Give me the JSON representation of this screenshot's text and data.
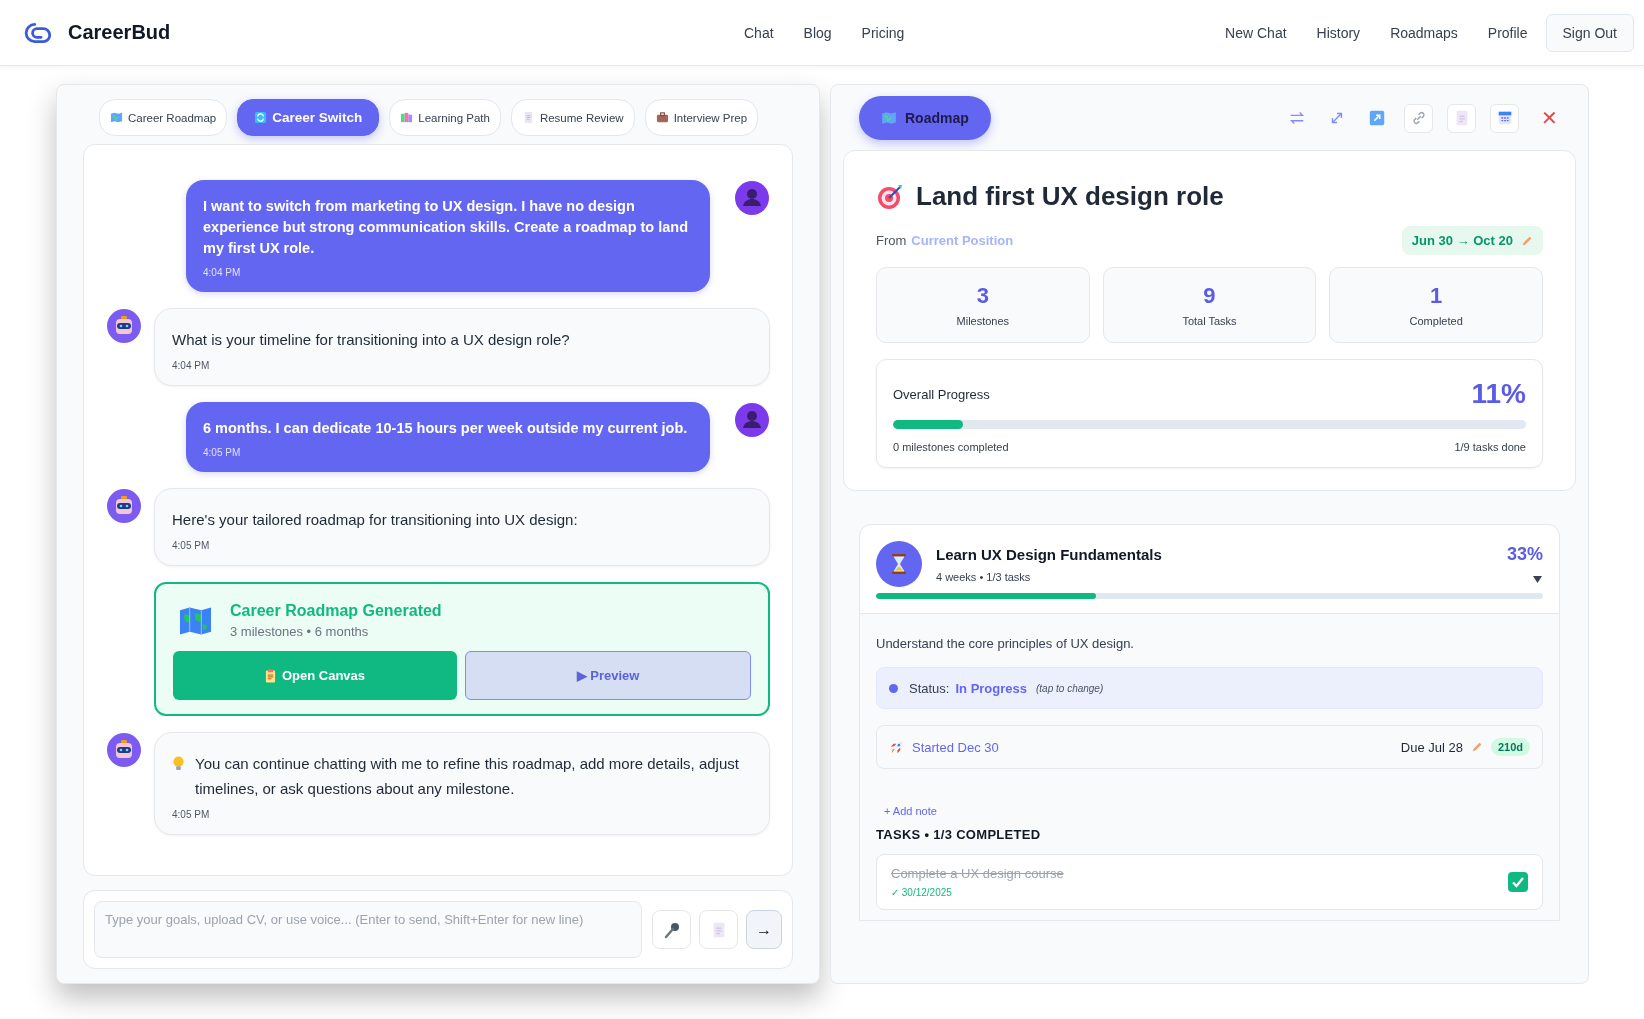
{
  "header": {
    "brand": "CareerBud",
    "nav_center": [
      "Chat",
      "Blog",
      "Pricing"
    ],
    "nav_right": [
      "New Chat",
      "History",
      "Roadmaps",
      "Profile"
    ],
    "sign_out": "Sign Out"
  },
  "tabs": [
    {
      "label": "Career Roadmap",
      "selected": false
    },
    {
      "label": "Career Switch",
      "selected": true
    },
    {
      "label": "Learning Path",
      "selected": false
    },
    {
      "label": "Resume Review",
      "selected": false
    },
    {
      "label": "Interview Prep",
      "selected": false
    }
  ],
  "messages": [
    {
      "kind": "user",
      "text": "I want to switch from marketing to UX design. I have no design experience but strong communication skills. Create a roadmap to land my first UX role.",
      "time": "4:04 PM"
    },
    {
      "kind": "bot",
      "text": "What is your timeline for transitioning into a UX design role?",
      "time": "4:04 PM"
    },
    {
      "kind": "user",
      "text": "6 months. I can dedicate 10-15 hours per week outside my current job.",
      "time": "4:05 PM"
    },
    {
      "kind": "bot",
      "text": "Here's your tailored roadmap for transitioning into UX design:",
      "time": "4:05 PM"
    },
    {
      "kind": "roadmap_card",
      "title": "Career Roadmap Generated",
      "subtitle": "3 milestones • 6 months",
      "open_label": "Open Canvas",
      "preview_label": "▶ Preview",
      "preview_disabled": true
    },
    {
      "kind": "bot_tip",
      "text": "You can continue chatting with me to refine this roadmap, add more details, adjust timelines, or ask questions about any milestone.",
      "time": "4:05 PM"
    }
  ],
  "composer": {
    "placeholder": "Type your goals, upload CV, or use voice... (Enter to send, Shift+Enter for new line)",
    "send": "→"
  },
  "canvas": {
    "tab": "Roadmap",
    "close": "✕",
    "title": "Land first UX design role",
    "from_label": "From",
    "from_value": "Current Position",
    "date_range": "Jun 30 → Oct 20",
    "stats": [
      {
        "value": "3",
        "label": "Milestones"
      },
      {
        "value": "9",
        "label": "Total Tasks"
      },
      {
        "value": "1",
        "label": "Completed"
      }
    ],
    "progress": {
      "label": "Overall Progress",
      "percent": "11%",
      "level": 0.11,
      "left": "0 milestones completed",
      "right": "1/9 tasks done"
    },
    "milestone": {
      "title": "Learn UX Design Fundamentals",
      "meta": "4 weeks • 1/3 tasks",
      "percent": "33%",
      "level": 0.33,
      "expanded": true,
      "description": "Understand the core principles of UX design.",
      "status_label": "Status:",
      "status_value": "In Progress",
      "status_hint": "(tap to change)",
      "started": "Started Dec 30",
      "due": "Due Jul 28",
      "days": "210d",
      "add_note": "+ Add note",
      "tasks_heading": "TASKS • 1/3 COMPLETED",
      "tasks": [
        {
          "title": "Complete a UX design course",
          "date": "✓ 30/12/2025",
          "checked": true
        }
      ]
    }
  }
}
